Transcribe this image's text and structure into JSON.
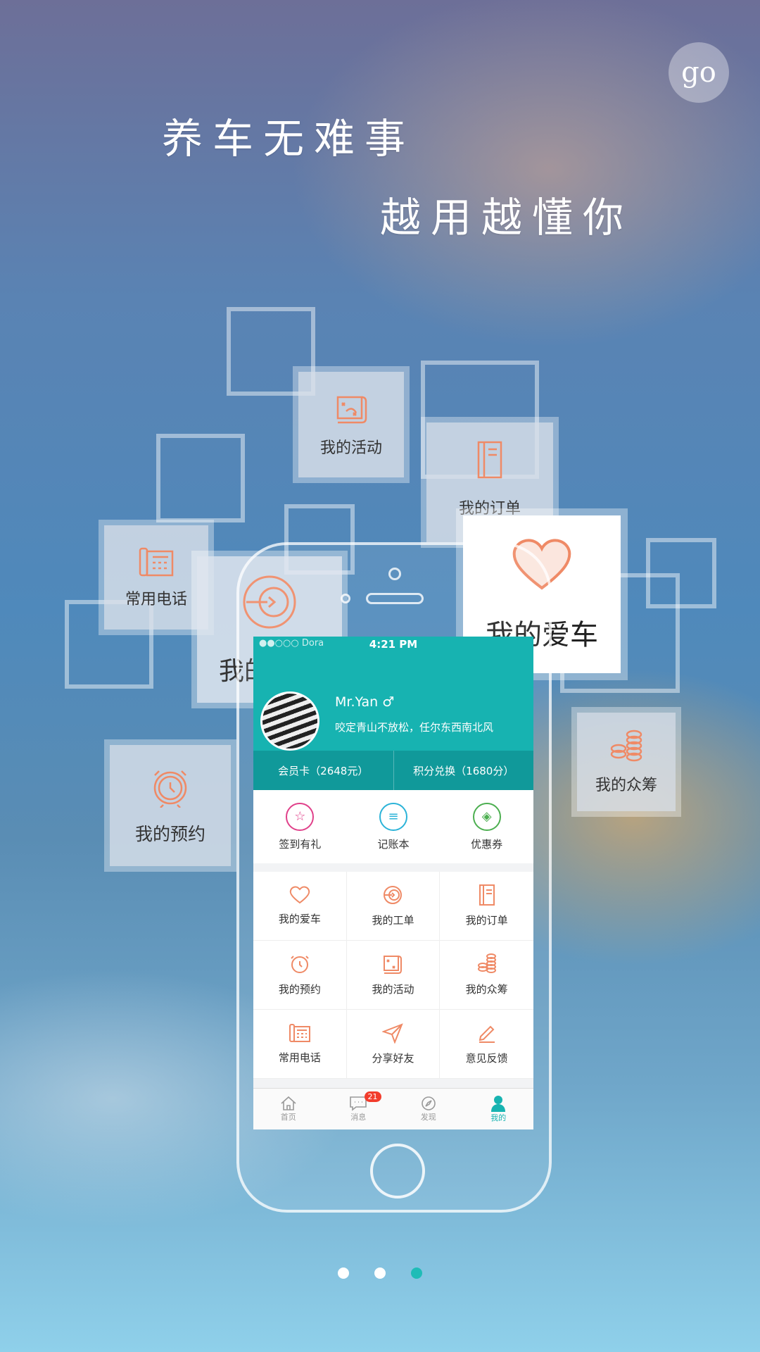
{
  "go_button": {
    "label": "go"
  },
  "slogan": {
    "line1": "养车无难事",
    "line2": "越用越懂你"
  },
  "cards": {
    "activity": "我的活动",
    "order": "我的订单",
    "phone": "常用电话",
    "workorder": "我的工单",
    "car": "我的爱车",
    "crowdfund": "我的众筹",
    "appointment": "我的预约"
  },
  "screen": {
    "status": {
      "carrier": "●●○○○ Dora",
      "time": "4:21 PM"
    },
    "user": {
      "name": "Mr.Yan ♂",
      "motto": "咬定青山不放松，任尔东西南北风"
    },
    "bar": {
      "member": "会员卡（2648元）",
      "points": "积分兑换（1680分）"
    },
    "quick": [
      {
        "label": "签到有礼",
        "icon": "star-icon",
        "color": "#e0408a"
      },
      {
        "label": "记账本",
        "icon": "ledger-icon",
        "color": "#2bb3d8"
      },
      {
        "label": "优惠券",
        "icon": "coupon-icon",
        "color": "#4caf50"
      }
    ],
    "grid": [
      {
        "label": "我的爱车",
        "icon": "heart-icon"
      },
      {
        "label": "我的工单",
        "icon": "workorder-icon"
      },
      {
        "label": "我的订单",
        "icon": "order-icon"
      },
      {
        "label": "我的预约",
        "icon": "alarm-clock-icon"
      },
      {
        "label": "我的活动",
        "icon": "map-icon"
      },
      {
        "label": "我的众筹",
        "icon": "coins-icon"
      },
      {
        "label": "常用电话",
        "icon": "telephone-icon"
      },
      {
        "label": "分享好友",
        "icon": "paper-plane-icon"
      },
      {
        "label": "意见反馈",
        "icon": "pencil-icon"
      }
    ],
    "tabs": [
      {
        "label": "首页",
        "icon": "home-icon"
      },
      {
        "label": "消息",
        "icon": "message-icon",
        "badge": "21"
      },
      {
        "label": "发现",
        "icon": "compass-icon"
      },
      {
        "label": "我的",
        "icon": "person-icon"
      }
    ]
  },
  "pagination": {
    "count": 3,
    "active_index": 2
  },
  "colors": {
    "accent": "#17b3b1",
    "icon_orange": "#ef8a66",
    "badge_red": "#f23c2c"
  }
}
